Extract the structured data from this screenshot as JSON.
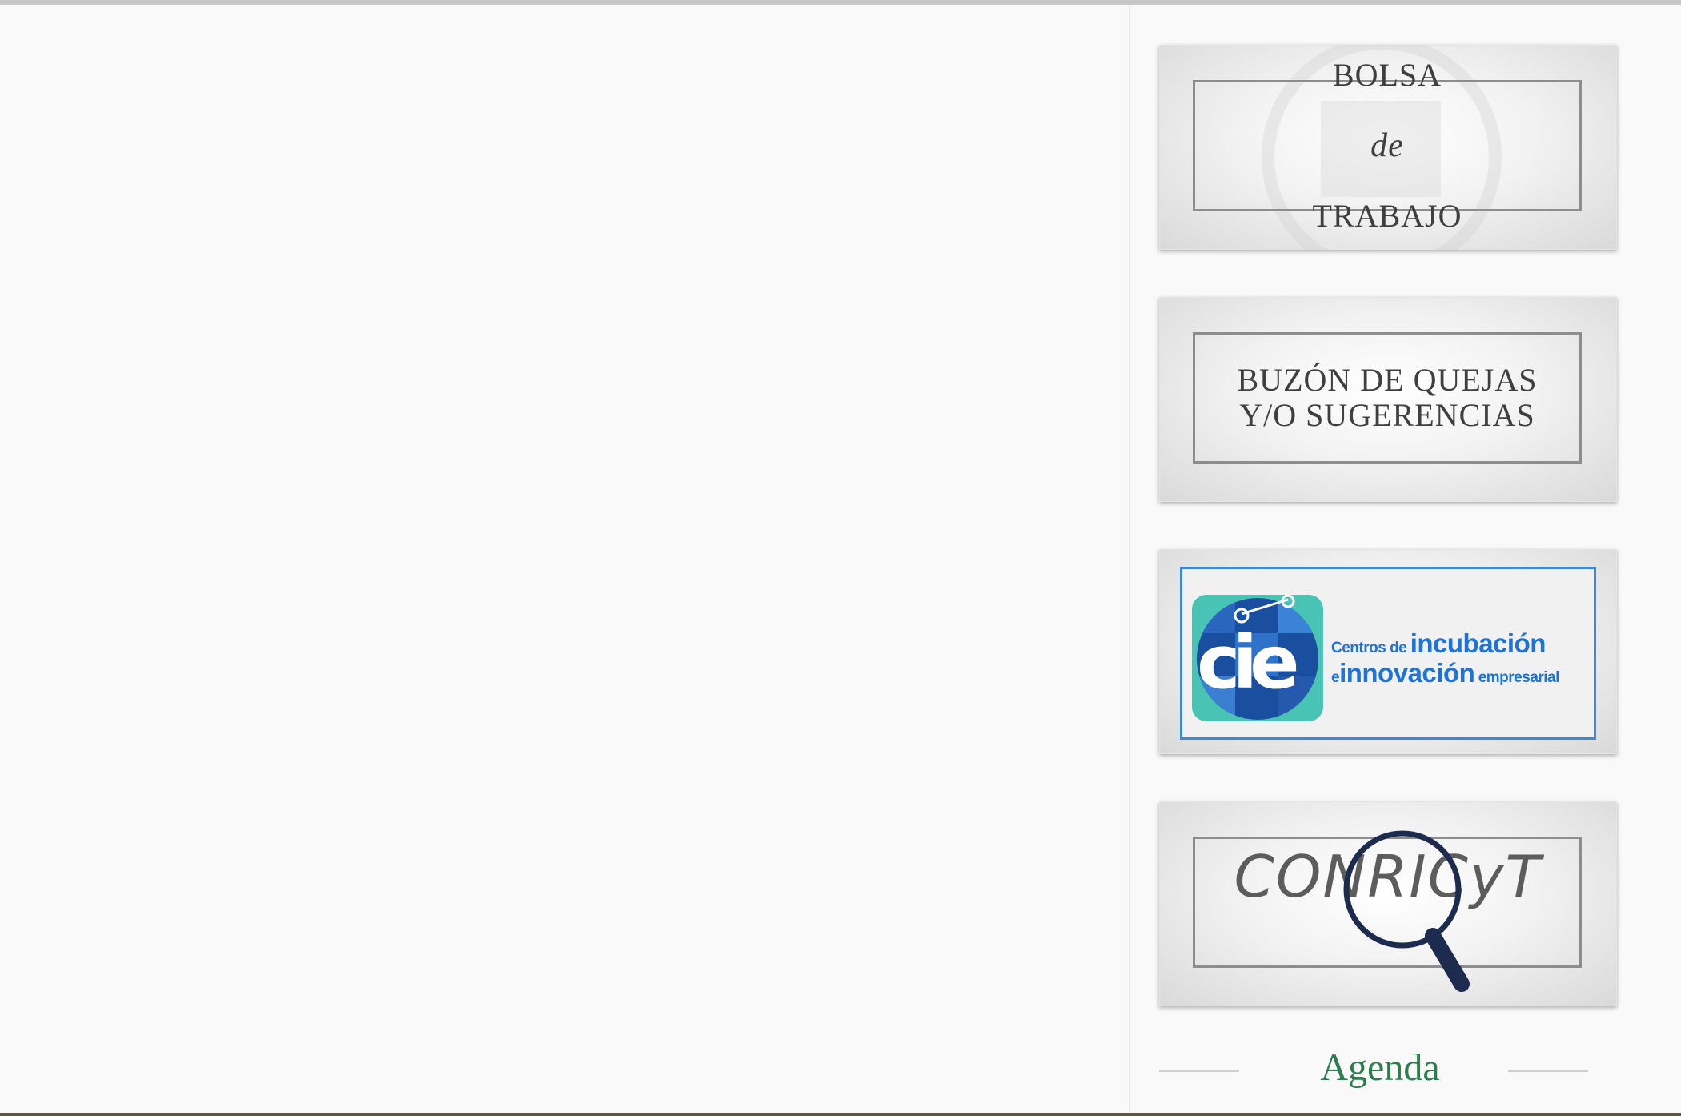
{
  "banners": {
    "bolsa": {
      "lines": [
        "BOLSA",
        "de",
        "TRABAJO"
      ]
    },
    "buzon": {
      "text": "BUZÓN DE QUEJAS\nY/O SUGERENCIAS"
    },
    "cie": {
      "logo_letters": "cie",
      "line1_small": "Centros de",
      "line1_big": "incubación",
      "line2_small": "e",
      "line2_big": "innovación",
      "line2_tail": "empresarial",
      "accent_color": "#1e73d6"
    },
    "conricyt": {
      "text": "CONRICyT"
    }
  },
  "agenda": {
    "title": "Agenda",
    "color": "#2e7d4e"
  },
  "icons": [
    "magnifier-icon",
    "cie-logo-icon",
    "briefcase-watermark-icon"
  ]
}
